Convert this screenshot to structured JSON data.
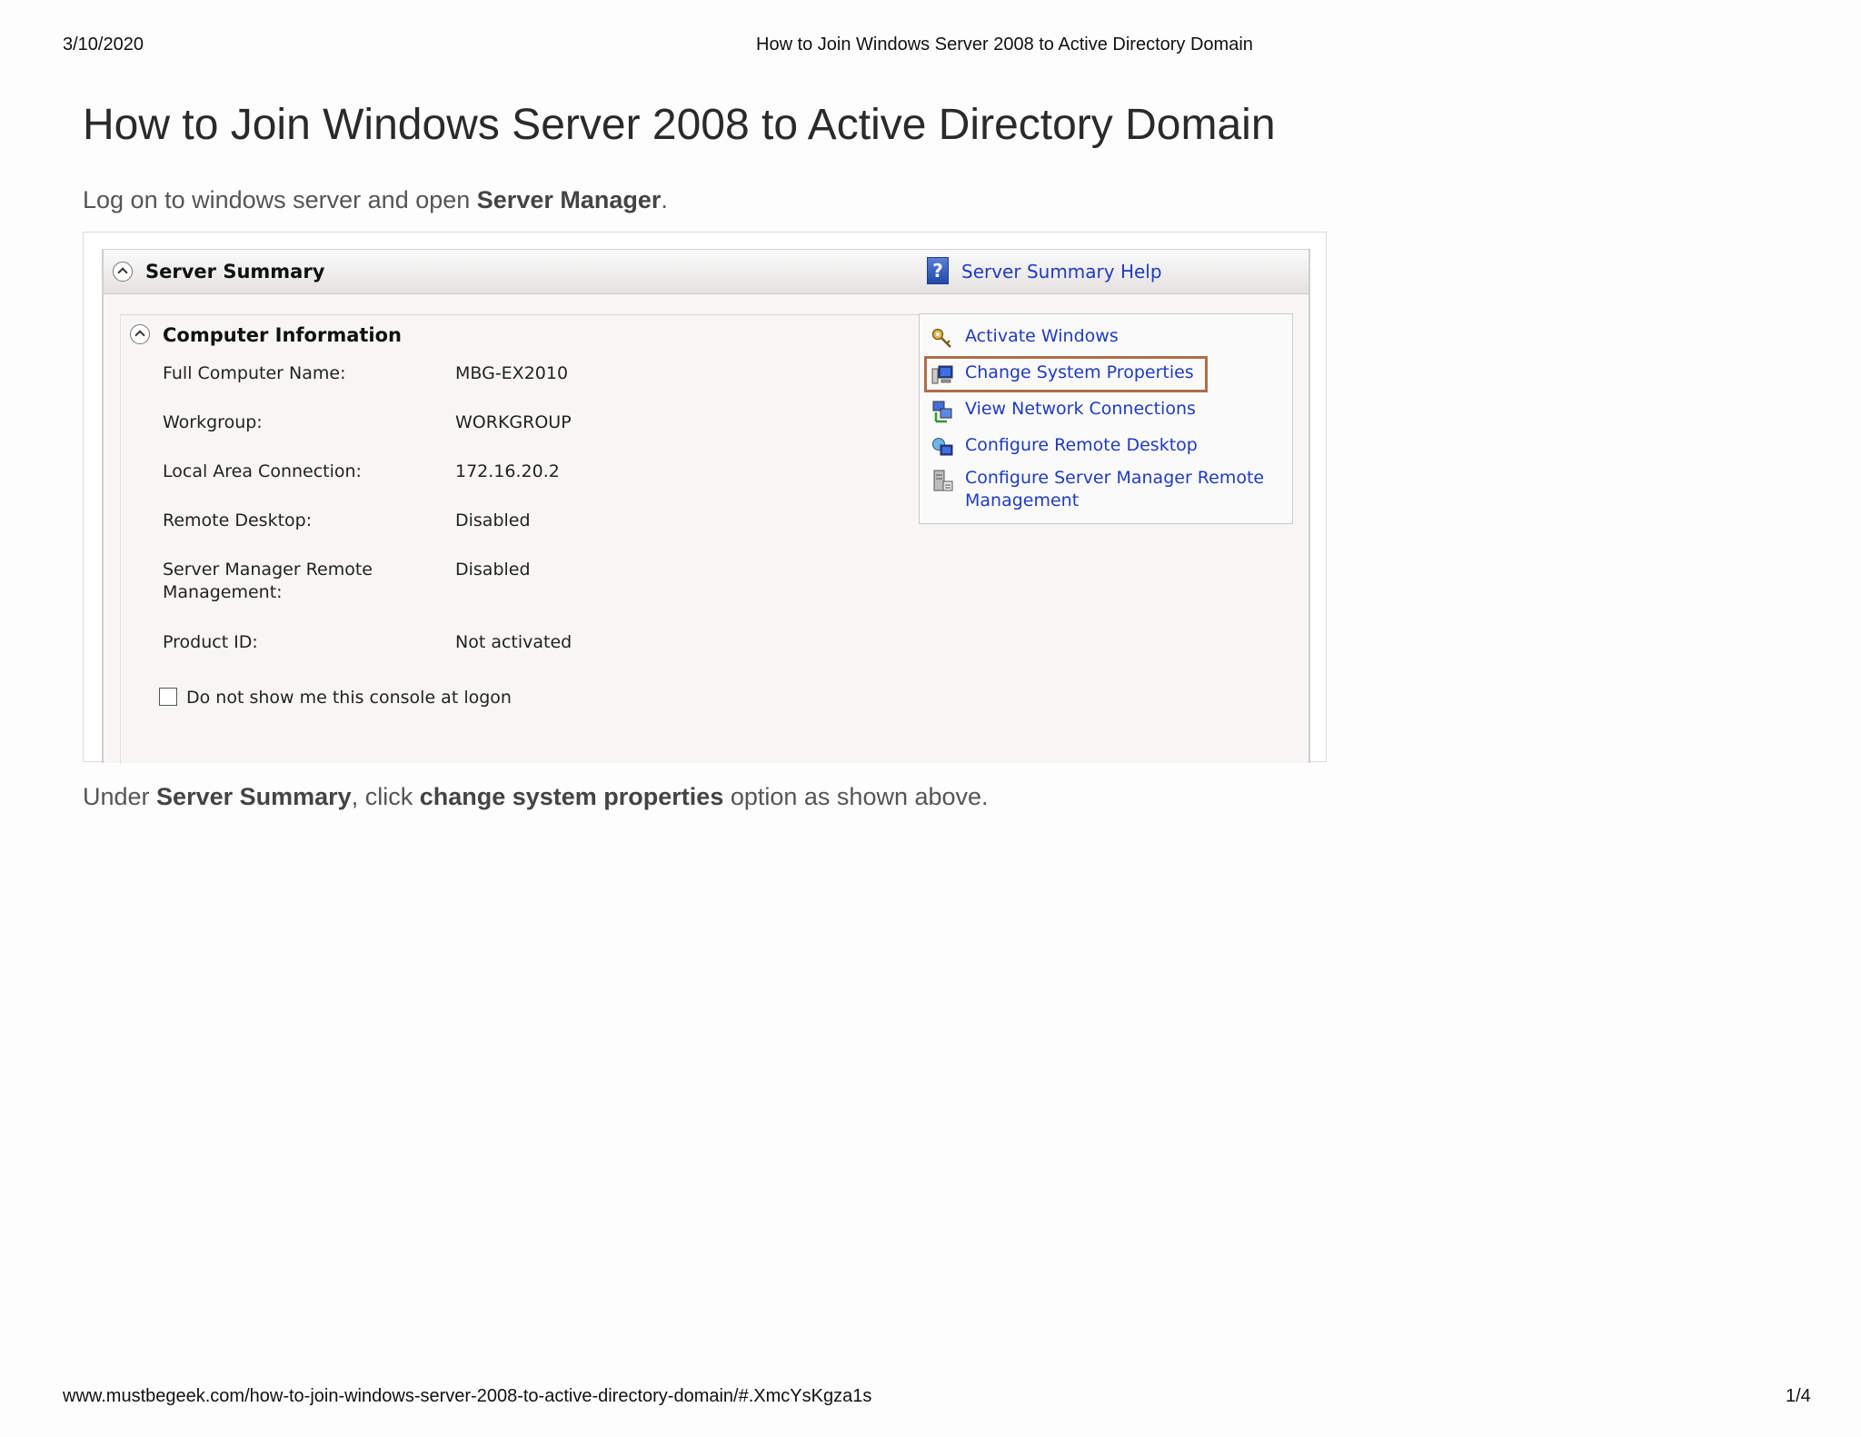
{
  "page_header": {
    "date": "3/10/2020",
    "title": "How to Join Windows Server 2008 to Active Directory Domain"
  },
  "article": {
    "title": "How to Join Windows Server 2008 to Active Directory Domain",
    "intro_prefix": "Log on to windows server and open ",
    "intro_bold": "Server Manager",
    "intro_suffix": ".",
    "after_prefix": "Under ",
    "after_bold1": "Server Summary",
    "after_mid": ", click ",
    "after_bold2": "change system properties",
    "after_suffix": " option as shown above."
  },
  "screenshot": {
    "section_title": "Server Summary",
    "help_icon": "help-question-icon",
    "help_label": "Server Summary Help",
    "computer_info_title": "Computer Information",
    "rows": [
      {
        "label": "Full Computer Name:",
        "value": "MBG-EX2010"
      },
      {
        "label": "Workgroup:",
        "value": "WORKGROUP"
      },
      {
        "label": "Local Area Connection:",
        "value": "172.16.20.2"
      },
      {
        "label": "Remote Desktop:",
        "value": "Disabled"
      },
      {
        "label": "Server Manager Remote Management:",
        "value": "Disabled"
      },
      {
        "label": "Product ID:",
        "value": "Not activated"
      }
    ],
    "checkbox_label": "Do not show me this console at logon",
    "tasks": [
      {
        "label": "Activate Windows",
        "icon": "keys-icon"
      },
      {
        "label": "Change System Properties",
        "icon": "computer-properties-icon"
      },
      {
        "label": "View Network Connections",
        "icon": "network-connections-icon"
      },
      {
        "label": "Configure Remote Desktop",
        "icon": "remote-desktop-icon"
      },
      {
        "label": "Configure Server Manager Remote Management",
        "icon": "server-manager-icon"
      }
    ],
    "highlight_color": "#b06d4a",
    "link_color": "#1f3bbf"
  },
  "page_footer": {
    "url": "www.mustbegeek.com/how-to-join-windows-server-2008-to-active-directory-domain/#.XmcYsKgza1s",
    "page": "1/4"
  }
}
